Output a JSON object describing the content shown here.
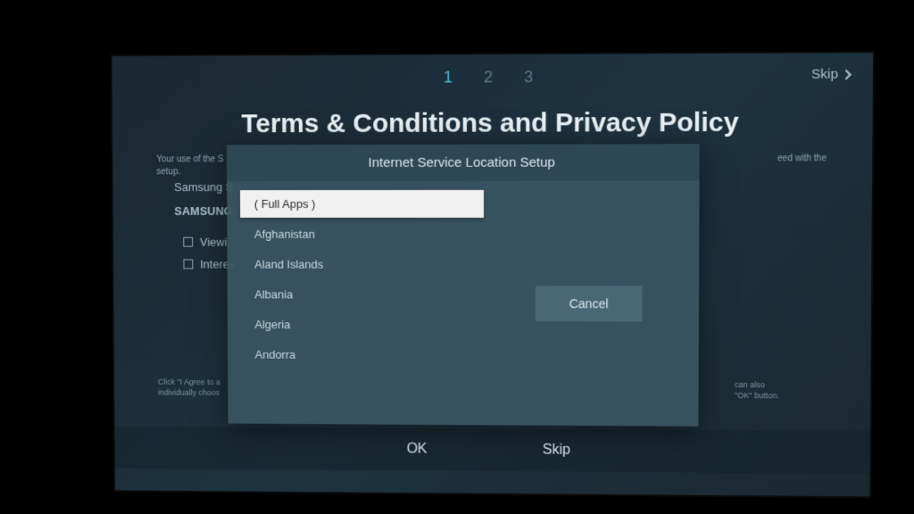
{
  "steps": [
    "1",
    "2",
    "3"
  ],
  "active_step": 0,
  "skip_top_label": "Skip",
  "page_title": "Terms & Conditions and Privacy Policy",
  "intro_text_left": "Your use of the S",
  "intro_text_right": "eed with the",
  "intro_text_setup": "setup.",
  "bg_items": {
    "item1": "Samsung S",
    "item2": "SAMSUNG",
    "checkbox1": "Viewi",
    "checkbox2": "Interes"
  },
  "footer_left": "Click \"I Agree to a",
  "footer_left2": "individually choos",
  "footer_right1": "can also",
  "footer_right2": "\"OK\" button.",
  "buttons": {
    "ok": "OK",
    "skip": "Skip"
  },
  "modal": {
    "title": "Internet Service Location Setup",
    "locations": [
      "( Full Apps )",
      "Afghanistan",
      "Aland Islands",
      "Albania",
      "Algeria",
      "Andorra"
    ],
    "selected_index": 0,
    "cancel_label": "Cancel"
  }
}
